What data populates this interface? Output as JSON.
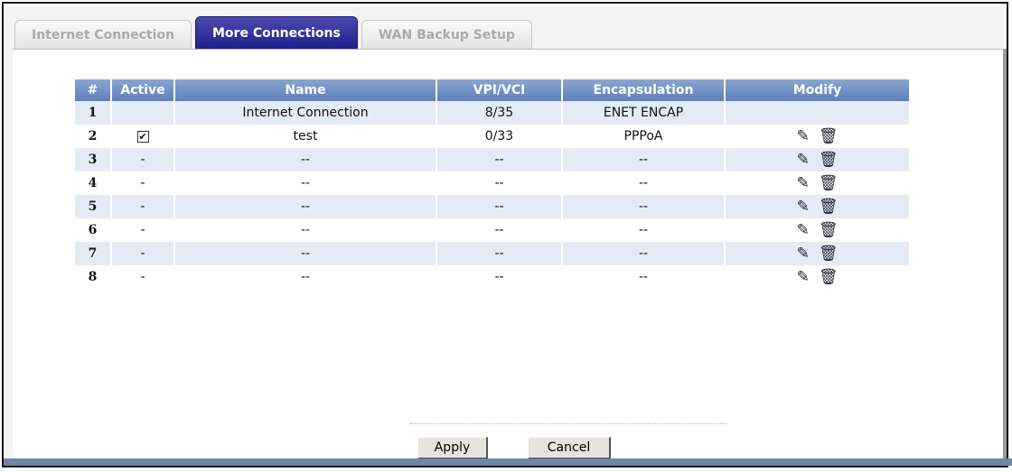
{
  "tabs": [
    {
      "label": "Internet Connection",
      "active": false
    },
    {
      "label": "More Connections",
      "active": true
    },
    {
      "label": "WAN Backup Setup",
      "active": false
    }
  ],
  "table": {
    "headers": [
      "#",
      "Active",
      "Name",
      "VPI/VCI",
      "Encapsulation",
      "Modify"
    ],
    "rows": [
      {
        "num": "1",
        "active": "",
        "name": "Internet Connection",
        "vpivci": "8/35",
        "encap": "ENET ENCAP",
        "modify": false
      },
      {
        "num": "2",
        "active": "checked",
        "name": "test",
        "vpivci": "0/33",
        "encap": "PPPoA",
        "modify": true
      },
      {
        "num": "3",
        "active": "-",
        "name": "--",
        "vpivci": "--",
        "encap": "--",
        "modify": true
      },
      {
        "num": "4",
        "active": "-",
        "name": "--",
        "vpivci": "--",
        "encap": "--",
        "modify": true
      },
      {
        "num": "5",
        "active": "-",
        "name": "--",
        "vpivci": "--",
        "encap": "--",
        "modify": true
      },
      {
        "num": "6",
        "active": "-",
        "name": "--",
        "vpivci": "--",
        "encap": "--",
        "modify": true
      },
      {
        "num": "7",
        "active": "-",
        "name": "--",
        "vpivci": "--",
        "encap": "--",
        "modify": true
      },
      {
        "num": "8",
        "active": "-",
        "name": "--",
        "vpivci": "--",
        "encap": "--",
        "modify": true
      }
    ]
  },
  "buttons": {
    "apply": "Apply",
    "cancel": "Cancel"
  }
}
